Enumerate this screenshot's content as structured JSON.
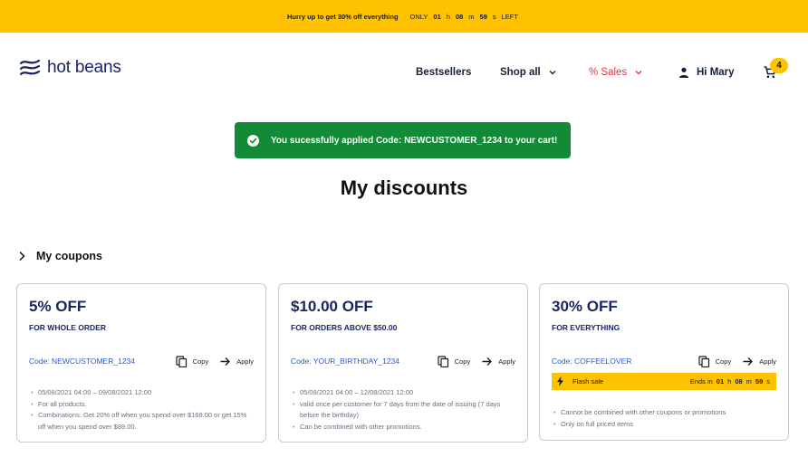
{
  "promo": {
    "message": "Hurry up to get 30% off everything",
    "only": "ONLY",
    "hours": "01",
    "h": "h",
    "minutes": "08",
    "m": "m",
    "seconds": "59",
    "s": "s",
    "left": "LEFT"
  },
  "brand": {
    "name": "hot beans"
  },
  "nav": {
    "bestsellers": "Bestsellers",
    "shop_all": "Shop all",
    "sales": "% Sales",
    "greeting": "Hi Mary"
  },
  "cart": {
    "count": "4"
  },
  "toast": {
    "message": "You sucessfully applied Code: NEWCUSTOMER_1234 to your cart!"
  },
  "page": {
    "title": "My discounts"
  },
  "coupons_section": {
    "title": "My coupons"
  },
  "coupons": [
    {
      "amount": "5% OFF",
      "subtitle": "FOR WHOLE ORDER",
      "code": "Code: NEWCUSTOMER_1234",
      "copy": "Copy",
      "apply": "Apply",
      "details": [
        "05/08/2021 04:00 – 09/08/2021 12:00",
        "For all products.",
        "Combinations: Get 20% off when you spend over $169.00 or get 15% off when you spend over $89.00."
      ]
    },
    {
      "amount": "$10.00 OFF",
      "subtitle": "FOR ORDERS ABOVE $50.00",
      "code": "Code: YOUR_BIRTHDAY_1234",
      "copy": "Copy",
      "apply": "Apply",
      "details": [
        "05/08/2021 04:00 – 12/08/2021 12:00",
        "valid once per customer for 7 days from the date of issuing (7 days before the birthday)",
        "Can be combined with other promotions."
      ]
    },
    {
      "amount": "30% OFF",
      "subtitle": "FOR EVERYTHING",
      "code": "Code: COFFEELOVER",
      "copy": "Copy",
      "apply": "Apply",
      "flash": {
        "label": "Flash sale",
        "ends_in": "Ends in",
        "hours": "01",
        "h": "h",
        "minutes": "08",
        "m": "m",
        "seconds": "59",
        "s": "s"
      },
      "details": [
        "Cannot be combined with other coupons or promotions",
        "Only on full priced items"
      ]
    }
  ],
  "colors": {
    "accent_yellow": "#ffc200",
    "brand_navy": "#1b2563",
    "success_green": "#138a36",
    "sale_red": "#e2363b",
    "code_blue": "#2e5bd1"
  },
  "icons": [
    "logo-icon",
    "chevron-down-icon",
    "user-icon",
    "cart-icon",
    "check-circle-icon",
    "chevron-right-icon",
    "copy-icon",
    "arrow-right-icon",
    "lightning-icon"
  ]
}
